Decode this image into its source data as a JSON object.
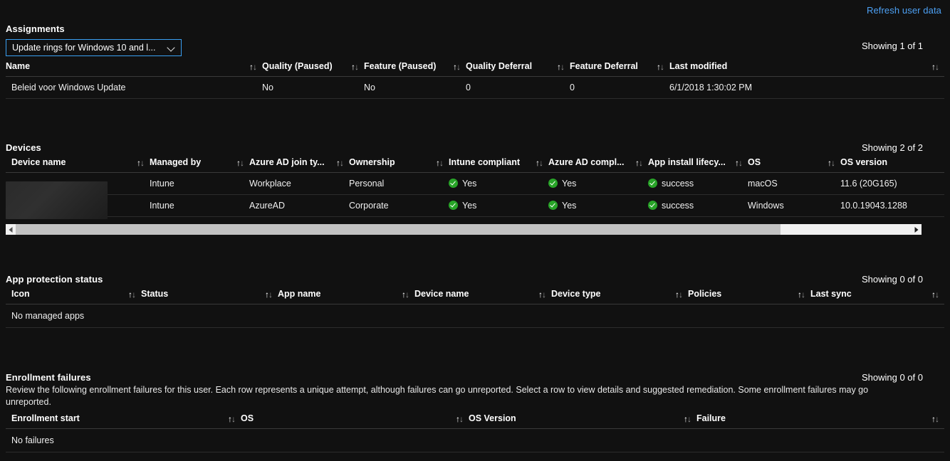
{
  "header": {
    "refresh_link": "Refresh user data"
  },
  "assignments": {
    "title": "Assignments",
    "filter": {
      "selected": "Update rings for Windows 10 and l...",
      "caret_icon": "chevron-down-icon"
    },
    "showing": "Showing 1 of 1",
    "columns": [
      "Name",
      "Quality (Paused)",
      "Feature (Paused)",
      "Quality Deferral",
      "Feature Deferral",
      "Last modified"
    ],
    "rows": [
      {
        "name": "Beleid voor Windows Update",
        "quality_paused": "No",
        "feature_paused": "No",
        "quality_deferral": "0",
        "feature_deferral": "0",
        "last_modified": "6/1/2018 1:30:02 PM"
      }
    ]
  },
  "devices": {
    "title": "Devices",
    "showing": "Showing 2 of 2",
    "columns": [
      "Device name",
      "Managed by",
      "Azure AD join ty...",
      "Ownership",
      "Intune compliant",
      "Azure AD compl...",
      "App install lifecy...",
      "OS",
      "OS version"
    ],
    "rows": [
      {
        "device_name": "",
        "managed_by": "Intune",
        "join_type": "Workplace",
        "ownership": "Personal",
        "intune_compliant": "Yes",
        "aad_compliant": "Yes",
        "app_install": "success",
        "os": "macOS",
        "os_version": "11.6 (20G165)"
      },
      {
        "device_name": "",
        "managed_by": "Intune",
        "join_type": "AzureAD",
        "ownership": "Corporate",
        "intune_compliant": "Yes",
        "aad_compliant": "Yes",
        "app_install": "success",
        "os": "Windows",
        "os_version": "10.0.19043.1288"
      }
    ],
    "scrollbar": {
      "left_arrow_icon": "caret-left-icon",
      "right_arrow_icon": "caret-right-icon"
    }
  },
  "app_protection": {
    "title": "App protection status",
    "showing": "Showing 0 of 0",
    "columns": [
      "Icon",
      "Status",
      "App name",
      "Device name",
      "Device type",
      "Policies",
      "Last sync"
    ],
    "empty_message": "No managed apps"
  },
  "enrollment_failures": {
    "title": "Enrollment failures",
    "description": "Review the following enrollment failures for this user. Each row represents a unique attempt, although failures can go unreported. Select a row to view details and suggested remediation. Some enrollment failures may go unreported.",
    "showing": "Showing 0 of 0",
    "columns": [
      "Enrollment start",
      "OS",
      "OS Version",
      "Failure"
    ],
    "empty_message": "No failures"
  },
  "colors": {
    "background": "#111111",
    "link": "#4da1f5",
    "accent_border": "#3aa0f3",
    "success": "#28a428",
    "header_rule": "#3a3a3a",
    "row_rule": "#2c2c2c",
    "scrollbar_track": "#f0f0f0",
    "scrollbar_thumb": "#c2c2c2"
  },
  "icons": {
    "sort": "sort-ascending-descending-icon",
    "success": "success-check-icon"
  }
}
